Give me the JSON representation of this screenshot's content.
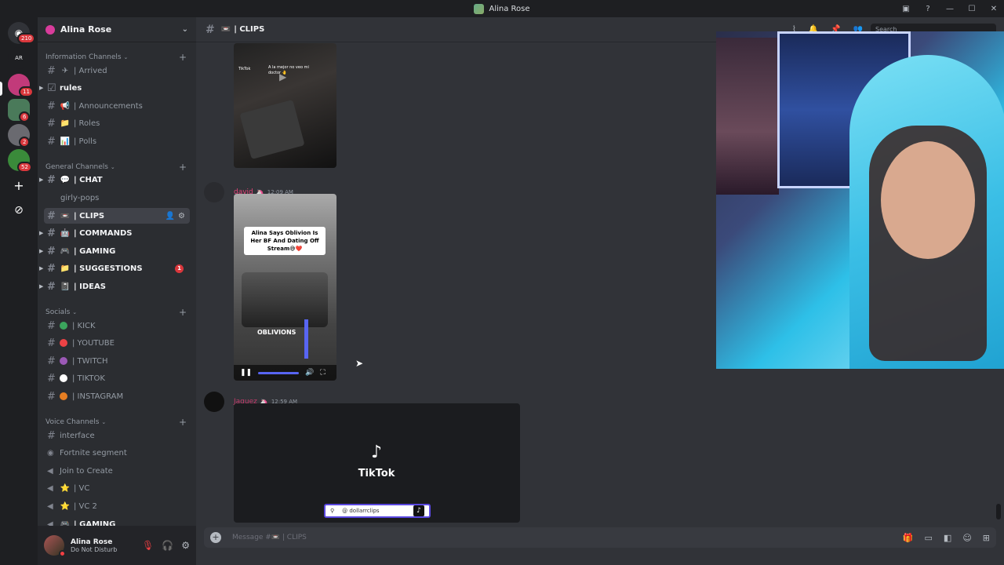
{
  "window": {
    "title": "Alina Rose"
  },
  "servers": {
    "home_badge": "210",
    "badges": [
      "11",
      "6",
      "2",
      "52"
    ]
  },
  "guild": {
    "name": "Alina Rose"
  },
  "categories": {
    "information": "Information Channels",
    "general": "General Channels",
    "socials": "Socials",
    "voice": "Voice Channels"
  },
  "info_channels": [
    {
      "emoji": "✈",
      "label": "| Arrived"
    },
    {
      "emoji": "☑",
      "label": "rules"
    },
    {
      "emoji": "📢",
      "label": "| Announcements"
    },
    {
      "emoji": "📁",
      "label": "| Roles"
    },
    {
      "emoji": "📊",
      "label": "| Polls"
    }
  ],
  "general_channels": [
    {
      "emoji": "💬",
      "label": "| CHAT"
    },
    {
      "emoji": "",
      "label": "girly-pops"
    },
    {
      "emoji": "📼",
      "label": "| CLIPS"
    },
    {
      "emoji": "🤖",
      "label": "| COMMANDS"
    },
    {
      "emoji": "🎮",
      "label": "| GAMING"
    },
    {
      "emoji": "📁",
      "label": "| SUGGESTIONS",
      "badge": "1"
    },
    {
      "emoji": "📓",
      "label": "| IDEAS"
    }
  ],
  "social_channels": [
    {
      "color": "#3ba55d",
      "label": "| KICK"
    },
    {
      "color": "#ed4245",
      "label": "| YOUTUBE"
    },
    {
      "color": "#9b59b6",
      "label": "| TWITCH"
    },
    {
      "color": "#ffffff",
      "label": "| TIKTOK"
    },
    {
      "color": "#e67e22",
      "label": "| INSTAGRAM"
    }
  ],
  "voice_channels": [
    {
      "label": "interface"
    },
    {
      "label": "Fortnite segment"
    },
    {
      "label": "Join to Create"
    },
    {
      "label": "| VC"
    },
    {
      "label": "| VC 2"
    },
    {
      "label": "| GAMING"
    }
  ],
  "user": {
    "name": "Alina Rose",
    "status": "Do Not Disturb"
  },
  "channel": {
    "emoji": "📼",
    "name": "| CLIPS"
  },
  "header": {
    "search_placeholder": "Search"
  },
  "messages": [
    {
      "author": "david",
      "time": "12:09 AM",
      "caption": "Alina Says Oblivion Is Her BF And Dating Off Stream😅❤️",
      "watermark": "OBLIVIONS"
    },
    {
      "author": "Jaquez",
      "time": "12:59 AM",
      "brand": "TikTok",
      "search_handle": "@ dollarrclips"
    }
  ],
  "first_video": {
    "caption": "A la mejor no veo mi doctor 🤚",
    "brand": "TikTok"
  },
  "composer": {
    "placeholder": "Message #📼 | CLIPS"
  }
}
